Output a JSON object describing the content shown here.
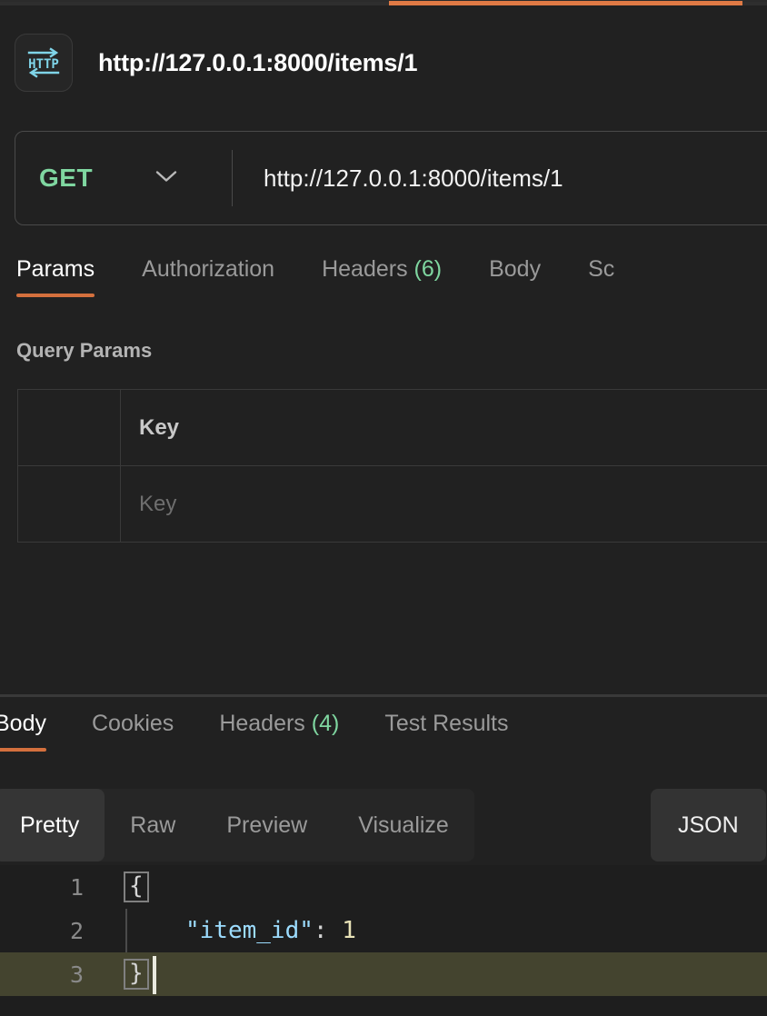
{
  "window": {
    "tab_accent_color": "#e07a45",
    "background_color": "#212121"
  },
  "request_header": {
    "icon": "http-protocol-icon",
    "icon_label": "HTTP",
    "title": "http://127.0.0.1:8000/items/1"
  },
  "url_bar": {
    "method": "GET",
    "method_color": "#7fd6a0",
    "method_dropdown_icon": "chevron-down-icon",
    "url": "http://127.0.0.1:8000/items/1"
  },
  "request_tabs": [
    {
      "label": "Params",
      "count": "",
      "active": true
    },
    {
      "label": "Authorization",
      "count": "",
      "active": false
    },
    {
      "label": "Headers",
      "count": "(6)",
      "active": false
    },
    {
      "label": "Body",
      "count": "",
      "active": false
    },
    {
      "label": "Sc",
      "count": "",
      "active": false
    }
  ],
  "query_params": {
    "section_title": "Query Params",
    "columns": [
      "",
      "Key"
    ],
    "header_key_label": "Key",
    "rows": [
      {
        "checkbox": "",
        "key_placeholder": "Key"
      }
    ]
  },
  "response_tabs": [
    {
      "label": "Body",
      "count": "",
      "active": true
    },
    {
      "label": "Cookies",
      "count": "",
      "active": false
    },
    {
      "label": "Headers",
      "count": "(4)",
      "active": false
    },
    {
      "label": "Test Results",
      "count": "",
      "active": false
    }
  ],
  "view_modes": [
    {
      "label": "Pretty",
      "active": true
    },
    {
      "label": "Raw",
      "active": false
    },
    {
      "label": "Preview",
      "active": false
    },
    {
      "label": "Visualize",
      "active": false
    }
  ],
  "format_selector": {
    "label": "JSON"
  },
  "response_body": {
    "language": "json",
    "lines": [
      {
        "number": "1",
        "text": "{",
        "kind": "brace",
        "highlighted": false
      },
      {
        "number": "2",
        "key": "\"item_id\"",
        "colon": ": ",
        "value": "1",
        "kind": "pair",
        "highlighted": false
      },
      {
        "number": "3",
        "text": "}",
        "kind": "brace",
        "highlighted": true
      }
    ]
  }
}
